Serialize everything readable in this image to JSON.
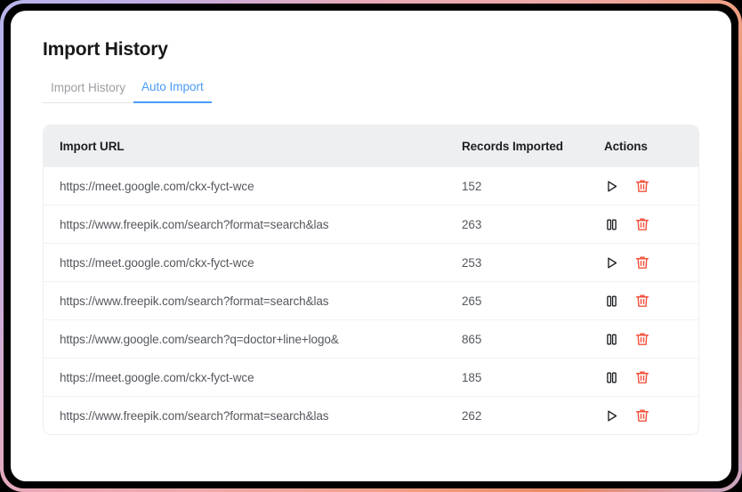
{
  "page": {
    "title": "Import History"
  },
  "tabs": [
    {
      "label": "Import History",
      "active": false,
      "name": "tab-import-history"
    },
    {
      "label": "Auto Import",
      "active": true,
      "name": "tab-auto-import"
    }
  ],
  "table": {
    "columns": [
      "Import URL",
      "Records Imported",
      "Actions"
    ],
    "rows": [
      {
        "url": "https://meet.google.com/ckx-fyct-wce",
        "records": "152",
        "action": "play",
        "delete": "delete"
      },
      {
        "url": "https://www.freepik.com/search?format=search&las",
        "records": "263",
        "action": "pause",
        "delete": "delete"
      },
      {
        "url": "https://meet.google.com/ckx-fyct-wce",
        "records": "253",
        "action": "play",
        "delete": "delete"
      },
      {
        "url": "https://www.freepik.com/search?format=search&las",
        "records": "265",
        "action": "pause",
        "delete": "delete"
      },
      {
        "url": "https://www.google.com/search?q=doctor+line+logo&",
        "records": "865",
        "action": "pause",
        "delete": "delete"
      },
      {
        "url": "https://meet.google.com/ckx-fyct-wce",
        "records": "185",
        "action": "pause",
        "delete": "delete"
      },
      {
        "url": "https://www.freepik.com/search?format=search&las",
        "records": "262",
        "action": "play",
        "delete": "delete"
      }
    ]
  },
  "colors": {
    "accent_blue": "#4a9bf5",
    "delete_red": "#f4513c",
    "icon_dark": "#1d1f22",
    "header_bg": "#eeeff1",
    "frame_purple": "#b7b4ec",
    "frame_pink": "#eeaaa9",
    "frame_orange": "#e78b64"
  },
  "icons": {
    "play": "play-icon",
    "pause": "pause-icon",
    "delete": "trash-icon"
  }
}
